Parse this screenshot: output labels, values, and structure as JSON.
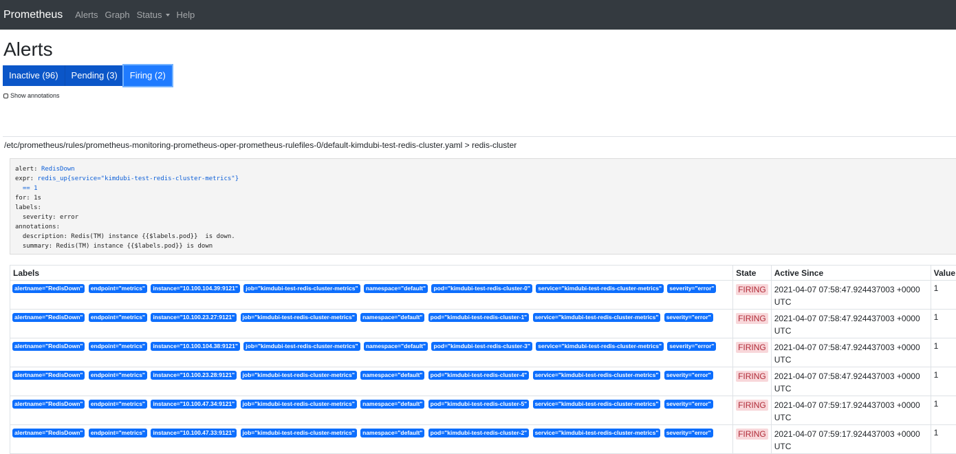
{
  "navbar": {
    "brand": "Prometheus",
    "items": [
      "Alerts",
      "Graph",
      "Status",
      "Help"
    ]
  },
  "page": {
    "title": "Alerts"
  },
  "tabs": [
    {
      "label": "Inactive (96)"
    },
    {
      "label": "Pending (3)"
    },
    {
      "label": "Firing (2)"
    }
  ],
  "show_annotations": {
    "label": "Show annotations"
  },
  "group": {
    "header": "/etc/prometheus/rules/prometheus-monitoring-prometheus-oper-prometheus-rulefiles-0/default-kimdubi-test-redis-cluster.yaml > redis-cluster"
  },
  "rule": {
    "alert_key": "alert: ",
    "alert_value": "RedisDown",
    "expr_key": "expr: ",
    "expr_value": "redis_up{service=\"kimdubi-test-redis-cluster-metrics\"}",
    "expr_cont": "  == 1",
    "for_line": "for: 1s",
    "labels_line": "labels:",
    "severity_line": "  severity: error",
    "annotations_line": "annotations:",
    "description_line": "  description: Redis(TM) instance {{$labels.pod}}  is down.",
    "summary_line": "  summary: Redis(TM) instance {{$labels.pod}} is down"
  },
  "table": {
    "headers": {
      "labels": "Labels",
      "state": "State",
      "active_since": "Active Since",
      "value": "Value"
    },
    "rows": [
      {
        "labels": [
          "alertname=\"RedisDown\"",
          "endpoint=\"metrics\"",
          "instance=\"10.100.104.39:9121\"",
          "job=\"kimdubi-test-redis-cluster-metrics\"",
          "namespace=\"default\"",
          "pod=\"kimdubi-test-redis-cluster-0\"",
          "service=\"kimdubi-test-redis-cluster-metrics\"",
          "severity=\"error\""
        ],
        "state": "FIRING",
        "since": "2021-04-07 07:58:47.924437003 +0000 UTC",
        "value": "1"
      },
      {
        "labels": [
          "alertname=\"RedisDown\"",
          "endpoint=\"metrics\"",
          "instance=\"10.100.23.27:9121\"",
          "job=\"kimdubi-test-redis-cluster-metrics\"",
          "namespace=\"default\"",
          "pod=\"kimdubi-test-redis-cluster-1\"",
          "service=\"kimdubi-test-redis-cluster-metrics\"",
          "severity=\"error\""
        ],
        "state": "FIRING",
        "since": "2021-04-07 07:58:47.924437003 +0000 UTC",
        "value": "1"
      },
      {
        "labels": [
          "alertname=\"RedisDown\"",
          "endpoint=\"metrics\"",
          "instance=\"10.100.104.38:9121\"",
          "job=\"kimdubi-test-redis-cluster-metrics\"",
          "namespace=\"default\"",
          "pod=\"kimdubi-test-redis-cluster-3\"",
          "service=\"kimdubi-test-redis-cluster-metrics\"",
          "severity=\"error\""
        ],
        "state": "FIRING",
        "since": "2021-04-07 07:58:47.924437003 +0000 UTC",
        "value": "1"
      },
      {
        "labels": [
          "alertname=\"RedisDown\"",
          "endpoint=\"metrics\"",
          "instance=\"10.100.23.28:9121\"",
          "job=\"kimdubi-test-redis-cluster-metrics\"",
          "namespace=\"default\"",
          "pod=\"kimdubi-test-redis-cluster-4\"",
          "service=\"kimdubi-test-redis-cluster-metrics\"",
          "severity=\"error\""
        ],
        "state": "FIRING",
        "since": "2021-04-07 07:58:47.924437003 +0000 UTC",
        "value": "1"
      },
      {
        "labels": [
          "alertname=\"RedisDown\"",
          "endpoint=\"metrics\"",
          "instance=\"10.100.47.34:9121\"",
          "job=\"kimdubi-test-redis-cluster-metrics\"",
          "namespace=\"default\"",
          "pod=\"kimdubi-test-redis-cluster-5\"",
          "service=\"kimdubi-test-redis-cluster-metrics\"",
          "severity=\"error\""
        ],
        "state": "FIRING",
        "since": "2021-04-07 07:59:17.924437003 +0000 UTC",
        "value": "1"
      },
      {
        "labels": [
          "alertname=\"RedisDown\"",
          "endpoint=\"metrics\"",
          "instance=\"10.100.47.33:9121\"",
          "job=\"kimdubi-test-redis-cluster-metrics\"",
          "namespace=\"default\"",
          "pod=\"kimdubi-test-redis-cluster-2\"",
          "service=\"kimdubi-test-redis-cluster-metrics\"",
          "severity=\"error\""
        ],
        "state": "FIRING",
        "since": "2021-04-07 07:59:17.924437003 +0000 UTC",
        "value": "1"
      }
    ]
  }
}
